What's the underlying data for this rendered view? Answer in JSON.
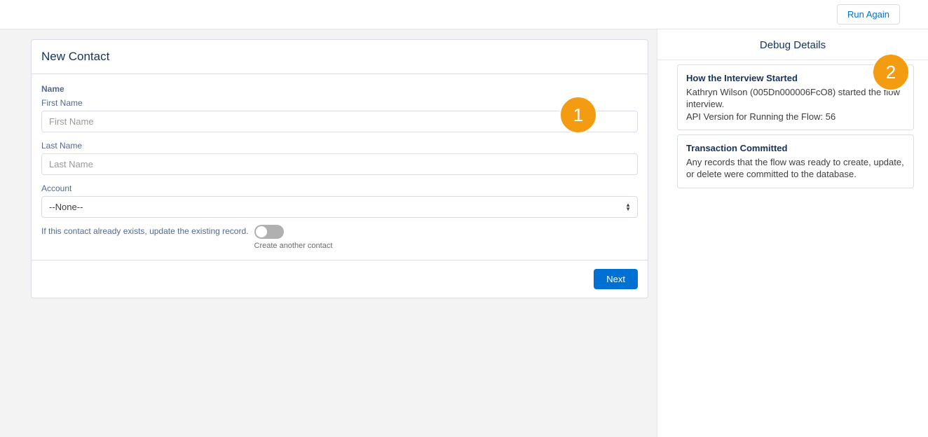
{
  "topbar": {
    "run_again": "Run Again"
  },
  "form": {
    "title": "New Contact",
    "section_name": "Name",
    "first_name_label": "First Name",
    "first_name_placeholder": "First Name",
    "last_name_label": "Last Name",
    "last_name_placeholder": "Last Name",
    "account_label": "Account",
    "account_value": "--None--",
    "toggle_description": "If this contact already exists, update the existing record.",
    "toggle_caption": "Create another contact",
    "next_button": "Next"
  },
  "debug": {
    "title": "Debug Details",
    "cards": [
      {
        "heading": "How the Interview Started",
        "body": "Kathryn Wilson (005Dn000006FcO8) started the flow interview.\nAPI Version for Running the Flow: 56"
      },
      {
        "heading": "Transaction Committed",
        "body": "Any records that the flow was ready to create, update, or delete were committed to the database."
      }
    ]
  },
  "annotations": {
    "badge1": "1",
    "badge2": "2"
  }
}
